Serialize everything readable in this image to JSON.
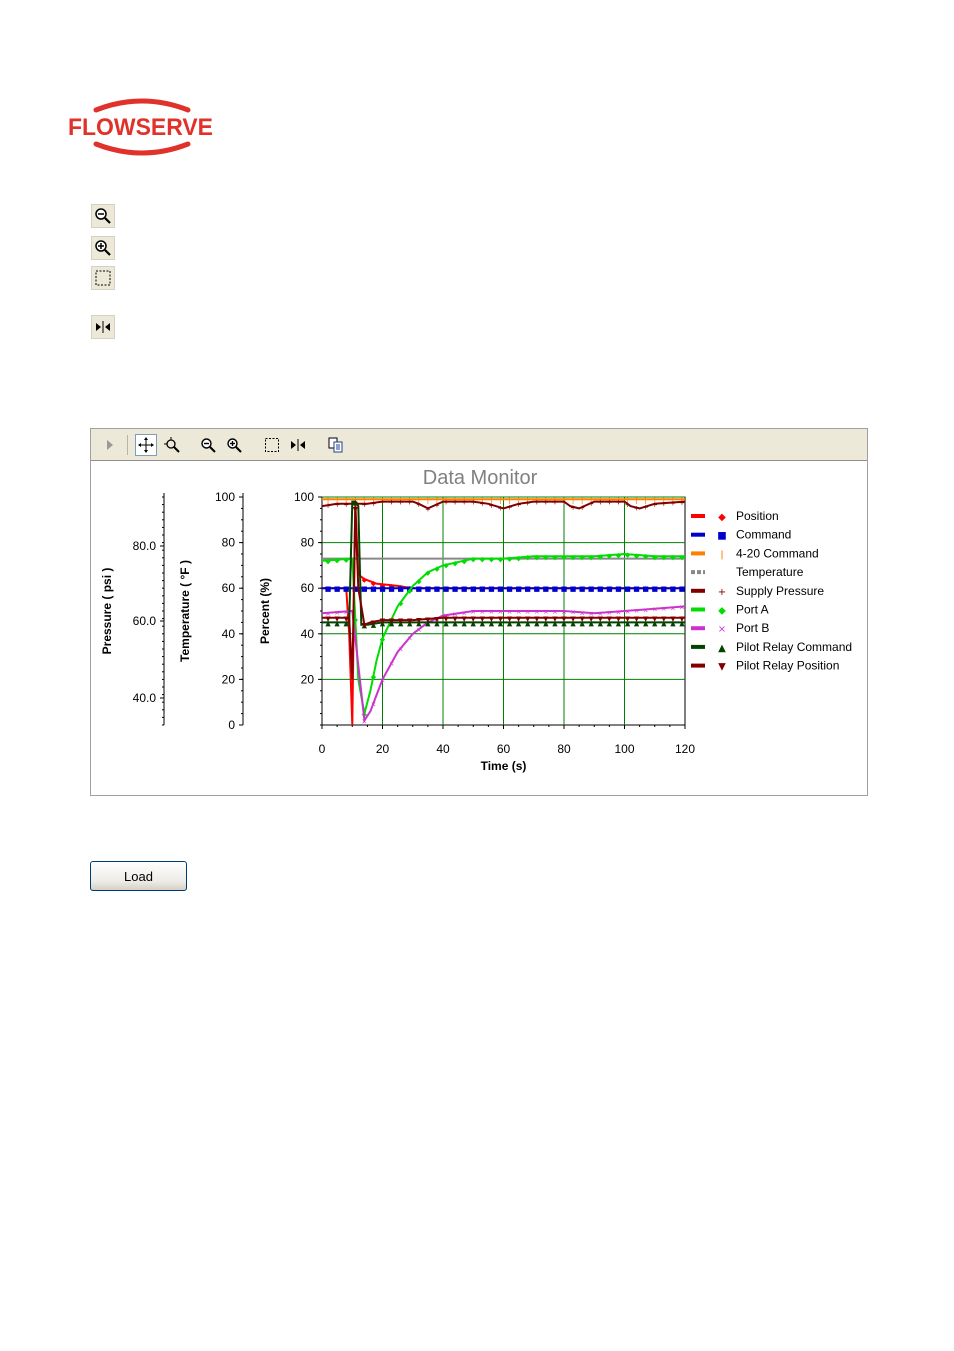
{
  "logo": {
    "text": "FLOWSERVE",
    "color": "#e0312a"
  },
  "side_tools": [
    {
      "name": "zoom-out-icon"
    },
    {
      "name": "zoom-in-icon"
    },
    {
      "name": "zoom-box-icon"
    },
    {
      "name": "fit-marker-icon"
    }
  ],
  "chart_toolbar": {
    "buttons": [
      "expand-arrow-icon",
      "pan-icon",
      "zoom-point-icon",
      "zoom-out-icon",
      "zoom-in-icon",
      "zoom-box-icon",
      "fit-marker-icon",
      "copy-icon"
    ]
  },
  "load_button": {
    "label": "Load"
  },
  "chart_data": {
    "type": "line",
    "title": "Data Monitor",
    "xlabel": "Time (s)",
    "xlim": [
      0,
      120
    ],
    "x_ticks": [
      "0",
      "20",
      "40",
      "60",
      "80",
      "100",
      "120"
    ],
    "grid": true,
    "legend_position": "right",
    "y_axes": [
      {
        "label": "Percent (%)",
        "ylim": [
          0,
          100
        ],
        "ticks": [
          "20",
          "40",
          "60",
          "80",
          "100"
        ]
      },
      {
        "label": "Temperature ( °F )",
        "ylim": [
          0,
          100
        ],
        "ticks": [
          "0",
          "20",
          "40",
          "60",
          "80",
          "100"
        ]
      },
      {
        "label": "Pressure ( psi )",
        "ticks": [
          "40.0",
          "60.0",
          "80.0"
        ]
      }
    ],
    "series": [
      {
        "name": "Position",
        "color": "#ff0000",
        "marker": "◆",
        "x": [
          0,
          8,
          9,
          10,
          11,
          12,
          14,
          18,
          25,
          30,
          40,
          60,
          80,
          100,
          120
        ],
        "y": [
          60,
          60,
          40,
          0,
          98,
          66,
          64,
          62,
          61,
          60,
          60,
          60,
          60,
          60,
          60
        ]
      },
      {
        "name": "Command",
        "color": "#0000cc",
        "marker": "■",
        "x": [
          0,
          20,
          40,
          60,
          80,
          100,
          120
        ],
        "y": [
          60,
          60,
          60,
          60,
          60,
          60,
          60
        ]
      },
      {
        "name": "4-20 Command",
        "color": "#ff8000",
        "marker": "ǀ",
        "x": [
          0,
          20,
          40,
          60,
          80,
          100,
          120
        ],
        "y": [
          99,
          99,
          99,
          99,
          99,
          99,
          99
        ]
      },
      {
        "name": "Temperature",
        "color": "#888888",
        "marker": "",
        "x": [
          0,
          20,
          40,
          60,
          80,
          100,
          120
        ],
        "y": [
          73,
          73,
          73,
          73,
          73,
          73,
          73
        ]
      },
      {
        "name": "Supply Pressure",
        "color": "#800000",
        "marker": "+",
        "x": [
          0,
          5,
          10,
          15,
          20,
          25,
          30,
          32,
          35,
          40,
          50,
          55,
          60,
          65,
          70,
          80,
          82,
          85,
          90,
          100,
          102,
          105,
          110,
          120
        ],
        "y": [
          96,
          97,
          97,
          97,
          98,
          98,
          98,
          97,
          95,
          98,
          98,
          97,
          95,
          97,
          98,
          98,
          96,
          95,
          98,
          98,
          96,
          95,
          97,
          98
        ]
      },
      {
        "name": "Port A",
        "color": "#00dd00",
        "marker": "◆",
        "x": [
          0,
          10,
          12,
          14,
          16,
          18,
          20,
          25,
          30,
          35,
          40,
          50,
          60,
          70,
          80,
          90,
          100,
          110,
          120
        ],
        "y": [
          72,
          73,
          20,
          5,
          15,
          28,
          38,
          52,
          61,
          67,
          70,
          73,
          73,
          74,
          74,
          74,
          75,
          74,
          74
        ]
      },
      {
        "name": "Port B",
        "color": "#cc33cc",
        "marker": "×",
        "x": [
          0,
          10,
          14,
          16,
          18,
          20,
          25,
          30,
          35,
          40,
          50,
          60,
          70,
          80,
          90,
          100,
          110,
          120
        ],
        "y": [
          49,
          50,
          2,
          6,
          13,
          20,
          32,
          40,
          45,
          48,
          50,
          50,
          50,
          50,
          49,
          50,
          51,
          52
        ]
      },
      {
        "name": "Pilot Relay Command",
        "color": "#004400",
        "marker": "▲",
        "x": [
          0,
          9,
          10,
          11,
          12,
          13,
          15,
          20,
          30,
          40,
          60,
          80,
          100,
          120
        ],
        "y": [
          45,
          45,
          98,
          98,
          96,
          44,
          44,
          45,
          45,
          45,
          45,
          45,
          45,
          45
        ]
      },
      {
        "name": "Pilot Relay Position",
        "color": "#800000",
        "marker": "▼",
        "x": [
          0,
          9,
          10,
          11,
          12,
          14,
          16,
          20,
          30,
          40,
          60,
          80,
          100,
          120
        ],
        "y": [
          47,
          47,
          20,
          95,
          60,
          44,
          45,
          46,
          46,
          47,
          47,
          47,
          47,
          47
        ]
      }
    ]
  }
}
